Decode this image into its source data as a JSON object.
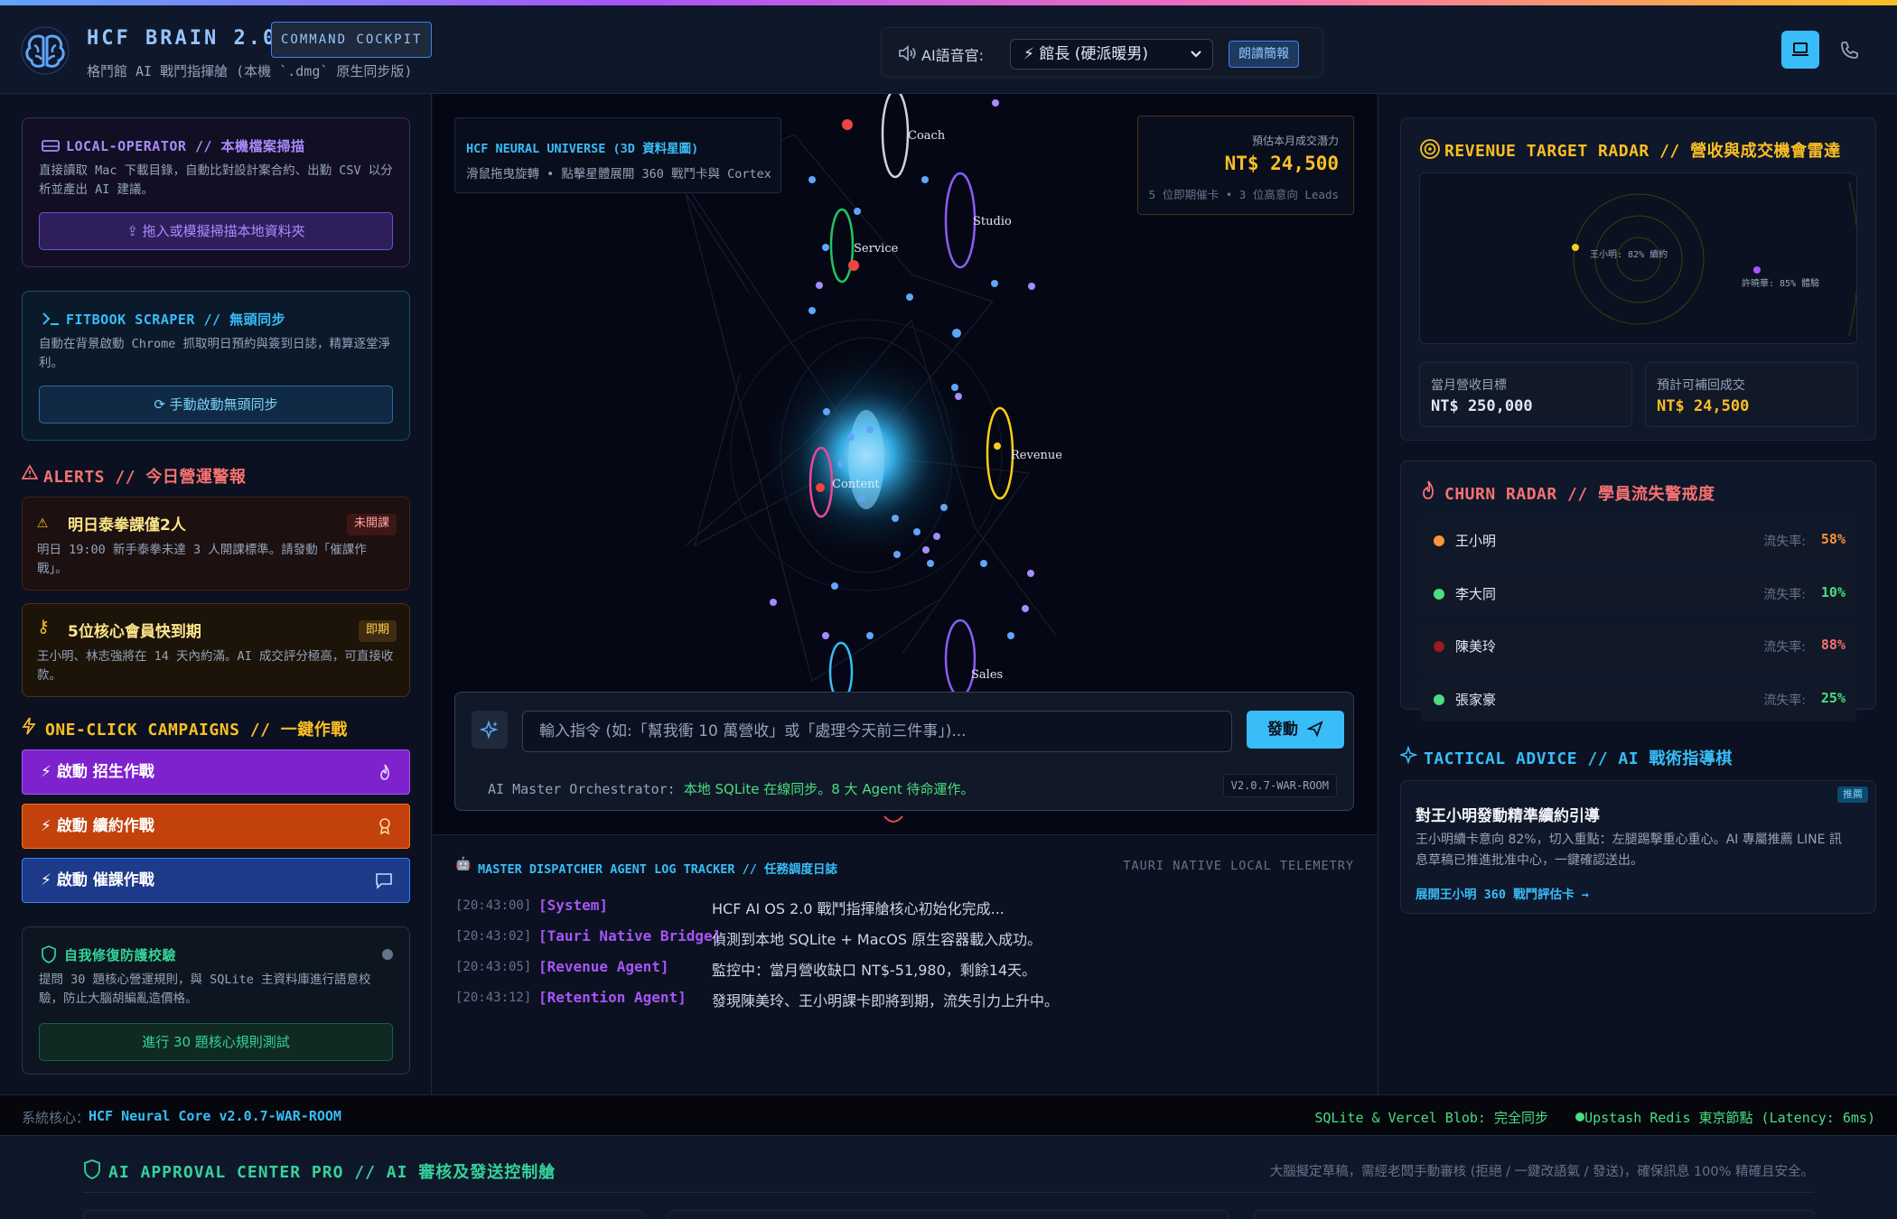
{
  "header": {
    "title": "HCF BRAIN 2.0",
    "badge": "COMMAND COCKPIT",
    "subtitle": "格鬥館 AI 戰鬥指揮艙 (本機 `.dmg` 原生同步版)",
    "voice_label": "AI語音官:",
    "voice_selected": "⚡ 館長 (硬派暖男)",
    "read_button": "朗讀簡報"
  },
  "left": {
    "local_operator": {
      "title": "LOCAL-OPERATOR // 本機檔案掃描",
      "desc": "直接讀取 Mac 下載目錄，自動比對設計案合約、出勤 CSV 以分析並產出 AI 建議。",
      "button": "拖入或模擬掃描本地資料夾"
    },
    "fitbook": {
      "title": "FITBOOK SCRAPER // 無頭同步",
      "desc": "自動在背景啟動 Chrome 抓取明日預約與簽到日誌，精算逐堂淨利。",
      "button": "手動啟動無頭同步"
    },
    "alerts": {
      "title": "ALERTS // 今日營運警報",
      "items": [
        {
          "title": "明日泰拳課僅2人",
          "tag": "未開課",
          "desc": "明日 19:00 新手泰拳未達 3 人開課標準。請發動「催課作戰」。"
        },
        {
          "title": "5位核心會員快到期",
          "tag": "即期",
          "desc": "王小明、林志強將在 14 天內約滿。AI 成交評分極高，可直接收款。"
        }
      ]
    },
    "campaigns": {
      "title": "ONE-CLICK CAMPAIGNS // 一鍵作戰",
      "buttons": [
        "⚡ 啟動 招生作戰",
        "⚡ 啟動 續約作戰",
        "⚡ 啟動 催課作戰"
      ]
    },
    "self_repair": {
      "title": "自我修復防護校驗",
      "desc": "提問 30 題核心營運規則，與 SQLite 主資料庫進行語意校驗，防止大腦胡編亂造價格。",
      "button": "進行 30 題核心規則測試"
    }
  },
  "universe": {
    "title": "HCF NEURAL UNIVERSE (3D 資料星圖)",
    "hint": "滑鼠拖曳旋轉 • 點擊星體展開 360 戰鬥卡與 Cortex",
    "nodes": [
      "Coach",
      "Studio",
      "Service",
      "Revenue",
      "Content",
      "Sales"
    ],
    "forecast_label": "預估本月成交潛力",
    "forecast_value": "NT$ 24,500",
    "forecast_sub": "5 位即期催卡 • 3 位高意向 Leads"
  },
  "command": {
    "placeholder": "輸入指令 (如:「幫我衝 10 萬營收」或「處理今天前三件事」)...",
    "button": "發動",
    "status_prefix": "AI Master Orchestrator:",
    "status_text": "本地 SQLite 在線同步。8 大 Agent 待命運作。",
    "version": "V2.0.7-WAR-ROOM"
  },
  "log": {
    "title": "MASTER DISPATCHER AGENT LOG TRACKER // 任務調度日誌",
    "right_label": "TAURI NATIVE LOCAL TELEMETRY",
    "rows": [
      {
        "time": "[20:43:00]",
        "agent": "[System]",
        "msg": "HCF AI OS 2.0 戰鬥指揮艙核心初始化完成..."
      },
      {
        "time": "[20:43:02]",
        "agent": "[Tauri Native Bridge]",
        "msg": "偵測到本地 SQLite + MacOS 原生容器載入成功。"
      },
      {
        "time": "[20:43:05]",
        "agent": "[Revenue Agent]",
        "msg": "監控中：當月營收缺口 NT$-51,980，剩餘14天。"
      },
      {
        "time": "[20:43:12]",
        "agent": "[Retention Agent]",
        "msg": "發現陳美玲、王小明課卡即將到期，流失引力上升中。"
      }
    ]
  },
  "right": {
    "revenue": {
      "title": "REVENUE TARGET RADAR // 營收與成交機會雷達",
      "point1": "王小明: 82% 續約",
      "point2": "許曉華: 85% 體驗",
      "target_label": "當月營收目標",
      "target_value": "NT$ 250,000",
      "recover_label": "預計可補回成交",
      "recover_value": "NT$ 24,500"
    },
    "churn": {
      "title": "CHURN RADAR // 學員流失警戒度",
      "rate_label": "流失率:",
      "rows": [
        {
          "name": "王小明",
          "pct": "58%",
          "color": "#fb923c"
        },
        {
          "name": "李大同",
          "pct": "10%",
          "color": "#4ade80"
        },
        {
          "name": "陳美玲",
          "pct": "88%",
          "color": "#f87171"
        },
        {
          "name": "張家豪",
          "pct": "25%",
          "color": "#4ade80"
        }
      ]
    },
    "tactical": {
      "title": "TACTICAL ADVICE // AI 戰術指導棋",
      "tag": "推薦",
      "heading": "對王小明發動精準續約引導",
      "desc": "王小明續卡意向 82%，切入重點：左腿踢擊重心重心。AI 專屬推薦 LINE 訊息草稿已推進批准中心，一鍵確認送出。",
      "link": "展開王小明 360 戰鬥評估卡 →"
    }
  },
  "footer": {
    "core_label": "系統核心：",
    "core_value": "HCF Neural Core v2.0.7-WAR-ROOM",
    "sync": "SQLite & Vercel Blob: 完全同步",
    "redis": "Upstash Redis 東京節點 (Latency: 6ms)"
  },
  "approval": {
    "title": "AI APPROVAL CENTER PRO // AI 審核及發送控制艙",
    "desc": "大腦擬定草稿，需經老闆手動審核 (拒絕 / 一鍵改語氣 / 發送)，確保訊息 100% 精確且安全。"
  }
}
